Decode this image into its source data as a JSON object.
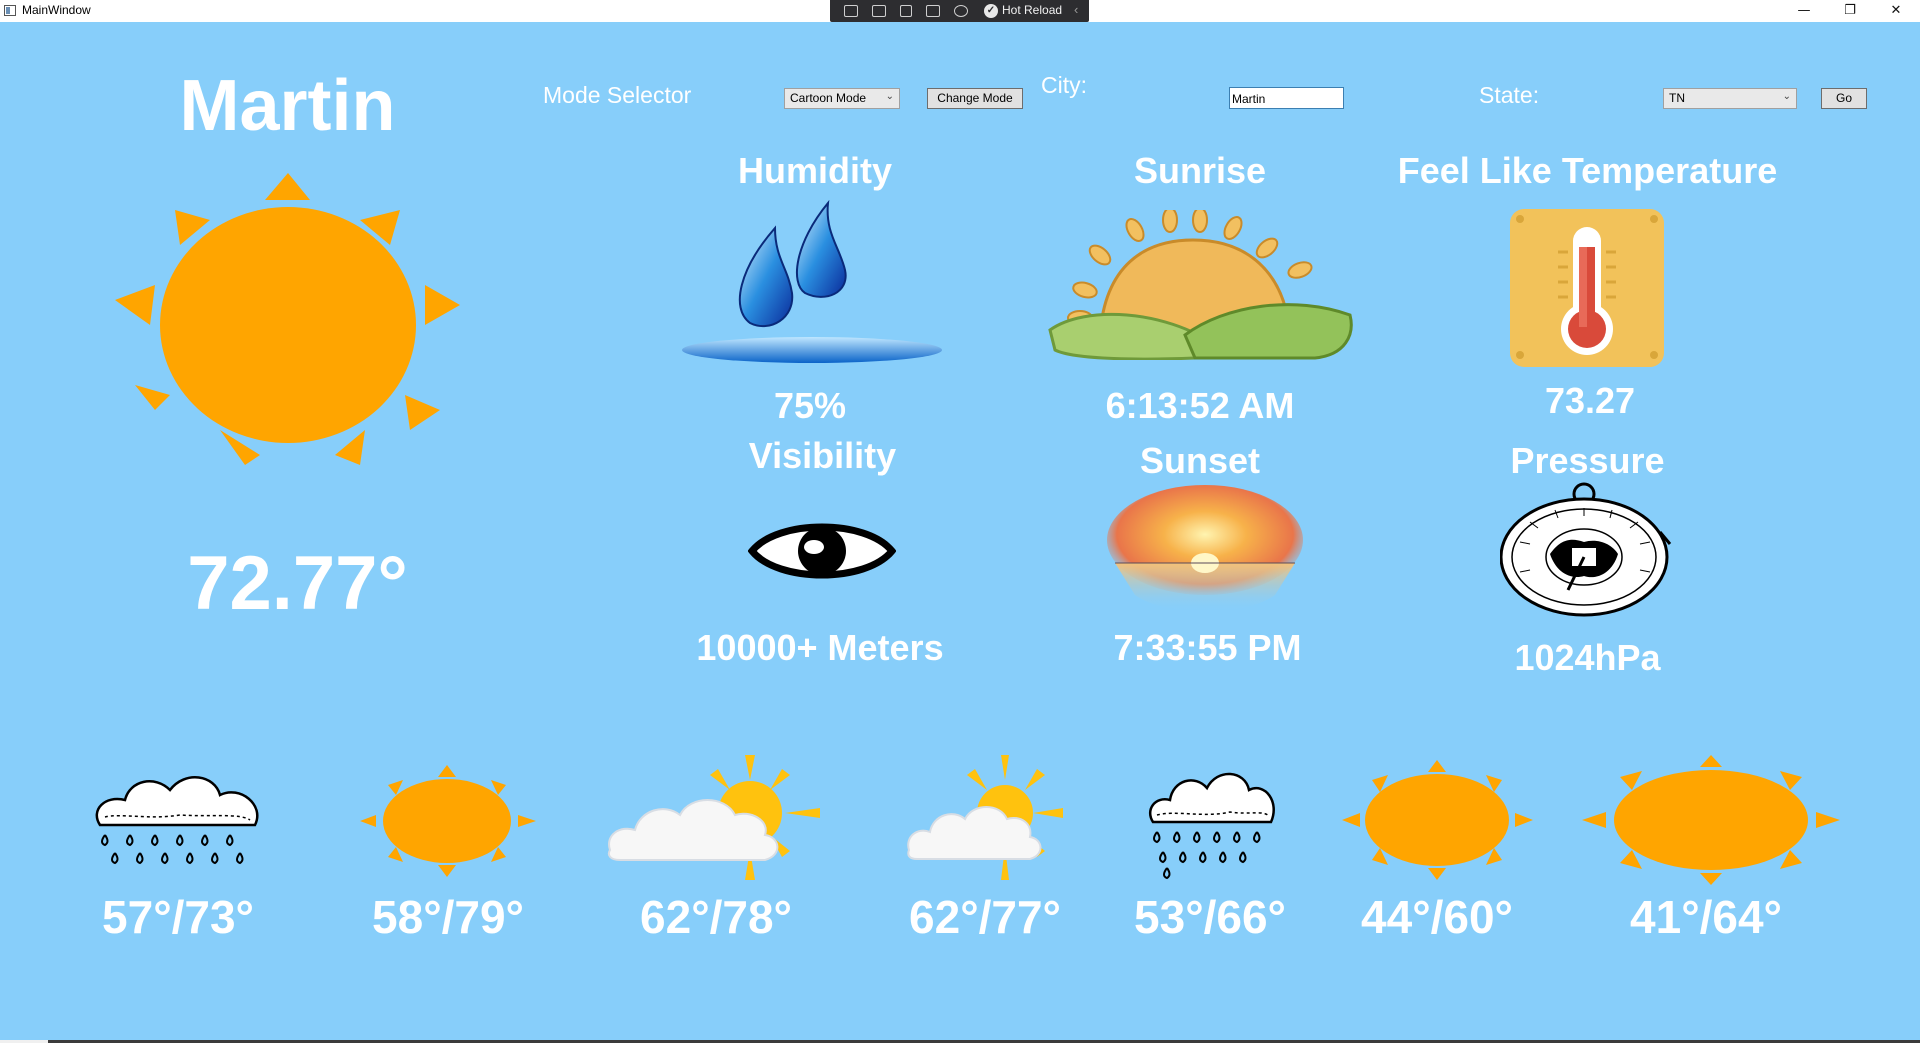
{
  "window": {
    "title": "MainWindow",
    "debug_toolbar_label": "Hot Reload",
    "controls": {
      "minimize": "—",
      "restore": "❐",
      "close": "✕"
    }
  },
  "main": {
    "city": "Martin",
    "temperature": "72.77°",
    "icon": "sun-icon"
  },
  "controls": {
    "mode_selector_label": "Mode Selector",
    "mode_value": "Cartoon Mode",
    "change_mode_label": "Change Mode",
    "city_label": "City:",
    "city_value": "Martin",
    "state_label": "State:",
    "state_value": "TN",
    "go_label": "Go"
  },
  "details": {
    "humidity": {
      "title": "Humidity",
      "value": "75%",
      "icon": "water-drops-icon"
    },
    "visibility": {
      "title": "Visibility",
      "value": "10000+ Meters",
      "icon": "eye-icon"
    },
    "sunrise": {
      "title": "Sunrise",
      "value": "6:13:52 AM",
      "icon": "sunrise-icon"
    },
    "sunset": {
      "title": "Sunset",
      "value": "7:33:55 PM",
      "icon": "sunset-icon"
    },
    "feels_like": {
      "title": "Feel Like Temperature",
      "value": "73.27",
      "icon": "thermometer-icon"
    },
    "pressure": {
      "title": "Pressure",
      "value": "1024hPa",
      "icon": "barometer-icon"
    }
  },
  "colors": {
    "background": "#87CEFA",
    "sun": "#FFA500",
    "text": "#FFFFFF"
  },
  "forecast": [
    {
      "temps": "57°/73°",
      "icon": "rain-cloud-icon"
    },
    {
      "temps": "58°/79°",
      "icon": "sun-icon"
    },
    {
      "temps": "62°/78°",
      "icon": "partly-cloudy-icon"
    },
    {
      "temps": "62°/77°",
      "icon": "partly-cloudy-icon"
    },
    {
      "temps": "53°/66°",
      "icon": "rain-cloud-icon"
    },
    {
      "temps": "44°/60°",
      "icon": "sun-icon"
    },
    {
      "temps": "41°/64°",
      "icon": "sun-icon"
    }
  ]
}
